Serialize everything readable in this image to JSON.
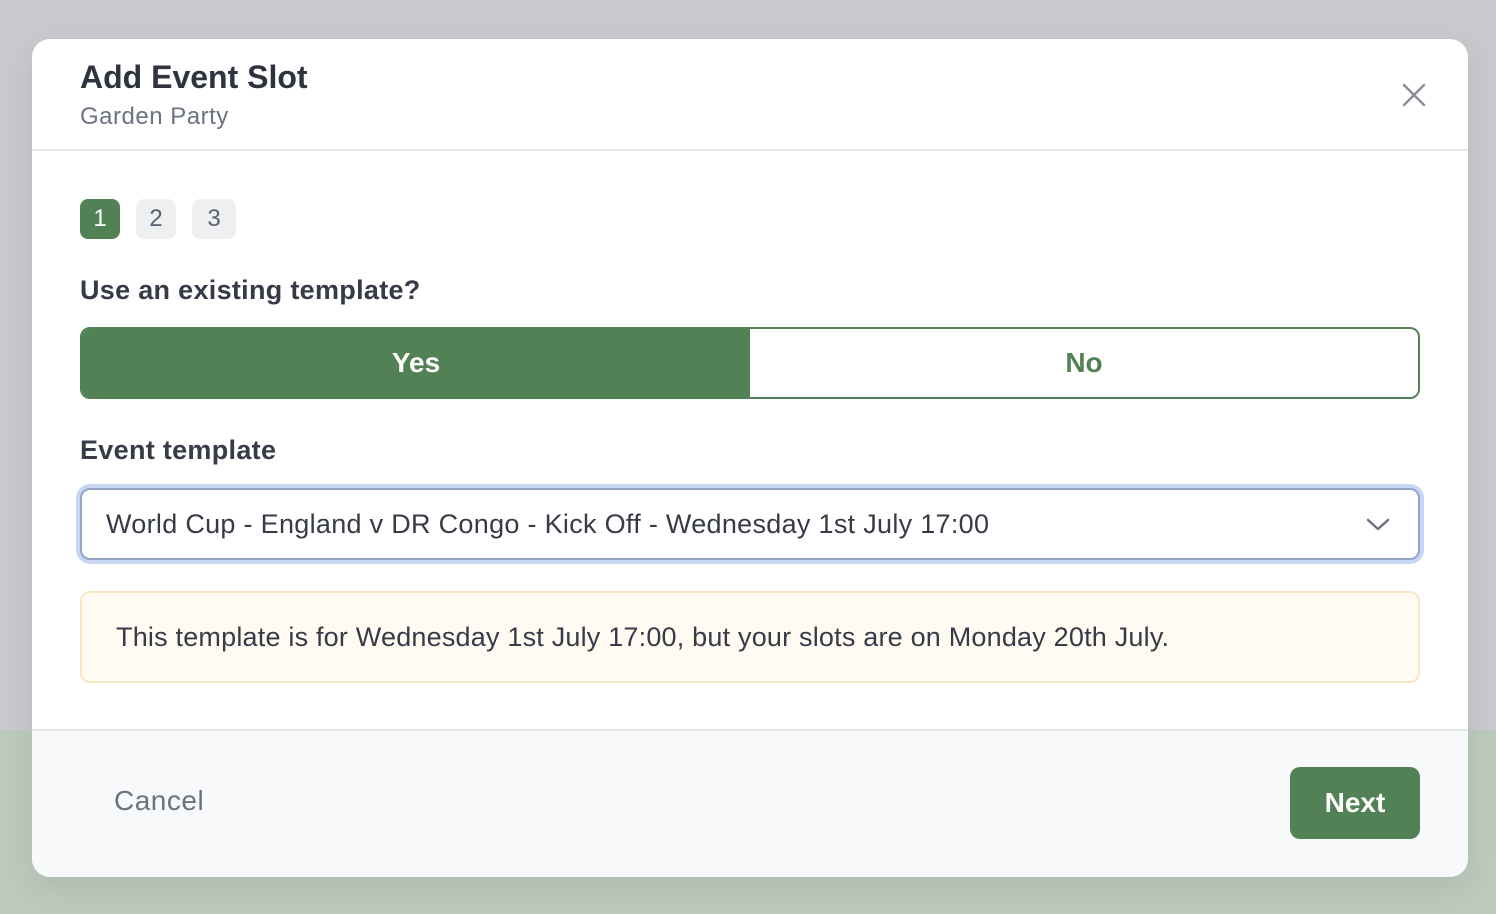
{
  "modal": {
    "title": "Add Event Slot",
    "subtitle": "Garden Party"
  },
  "steps": [
    {
      "label": "1",
      "active": true
    },
    {
      "label": "2",
      "active": false
    },
    {
      "label": "3",
      "active": false
    }
  ],
  "template_question": {
    "label": "Use an existing template?",
    "yes_label": "Yes",
    "no_label": "No",
    "selected": "Yes"
  },
  "event_template": {
    "label": "Event template",
    "selected_value": "World Cup - England v DR Congo - Kick Off - Wednesday 1st July 17:00"
  },
  "notice": {
    "text": "This template is for Wednesday 1st July 17:00, but your slots are on Monday 20th July."
  },
  "footer": {
    "cancel_label": "Cancel",
    "next_label": "Next"
  },
  "colors": {
    "accent": "#528155",
    "notice_bg": "#fffbf3",
    "notice_border": "#fbe6c3",
    "focus_ring": "#c7d6f3"
  },
  "icons": {
    "close": "close-icon",
    "dropdown": "chevron-down-icon"
  }
}
